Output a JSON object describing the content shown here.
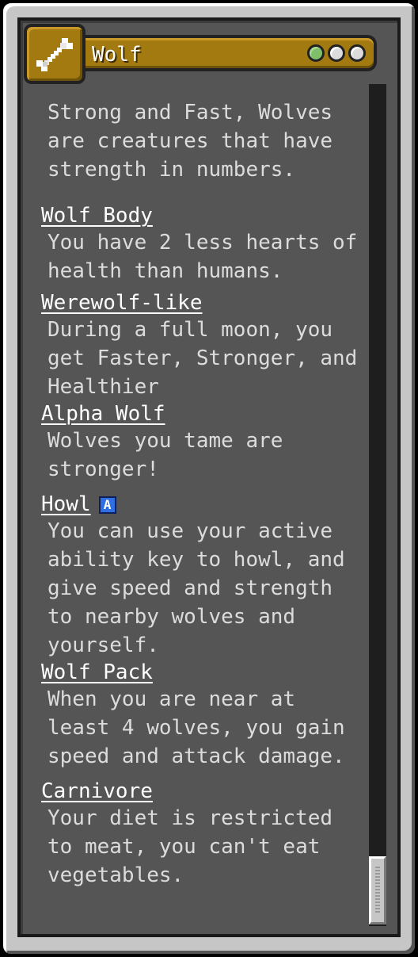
{
  "origin": {
    "name": "Wolf",
    "icon": "bone-icon",
    "impact_levels": [
      "green",
      "white",
      "white"
    ],
    "description": "Strong and Fast, Wolves are creatures that have strength in numbers."
  },
  "powers": [
    {
      "name": "Wolf Body",
      "text": "You have 2 less hearts of health than humans.",
      "active": false
    },
    {
      "name": "Werewolf-like",
      "text": "During a full moon, you get Faster, Stronger, and Healthier",
      "active": false
    },
    {
      "name": "Alpha Wolf",
      "text": "Wolves you tame are stronger!",
      "active": false
    },
    {
      "name": "Howl",
      "text": "You can use your active ability key to howl, and give speed and strength to nearby wolves and yourself.",
      "active": true,
      "badge": "A"
    },
    {
      "name": "Wolf Pack",
      "text": "When you are near at least 4 wolves, you gain speed and attack damage.",
      "active": false
    },
    {
      "name": "Carnivore",
      "text": "Your diet is restricted to meat, you can't eat vegetables.",
      "active": false
    }
  ],
  "colors": {
    "frame": "#c6c6c6",
    "panel": "#555555",
    "header_gold": "#a37a10",
    "active_badge": "#2f6fe0"
  }
}
